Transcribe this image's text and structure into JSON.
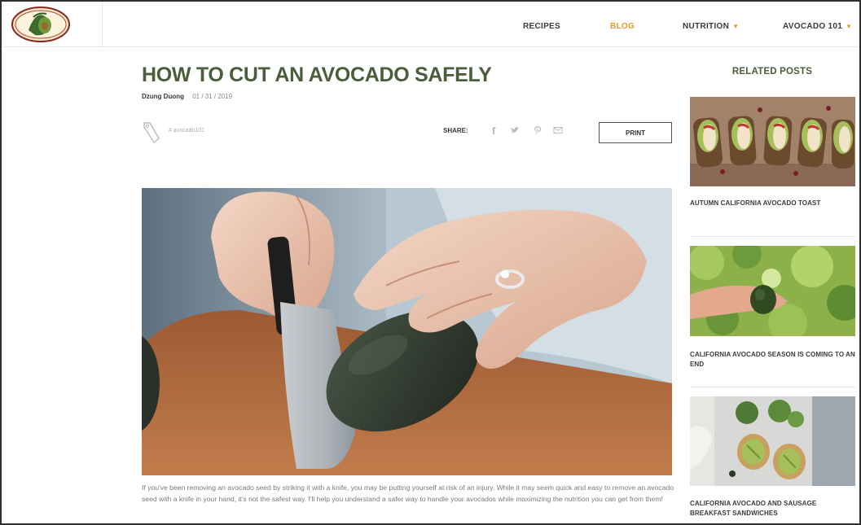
{
  "header": {
    "logo_text": "CALIFORNIA AVOCADOS",
    "nav": [
      {
        "label": "RECIPES",
        "active": false,
        "has_dropdown": false
      },
      {
        "label": "BLOG",
        "active": true,
        "has_dropdown": false
      },
      {
        "label": "NUTRITION",
        "active": false,
        "has_dropdown": true
      },
      {
        "label": "AVOCADO 101",
        "active": false,
        "has_dropdown": true
      }
    ]
  },
  "article": {
    "title": "HOW TO CUT AN AVOCADO SAFELY",
    "author": "Dzung Duong",
    "date": "01 / 31 / 2019",
    "tag": "# avocado101",
    "share_label": "SHARE:",
    "share_icons": [
      "facebook-icon",
      "twitter-icon",
      "pinterest-icon",
      "email-icon"
    ],
    "print_label": "PRINT",
    "hero_alt": "Cutting an avocado on a cutting board",
    "body": "If you've been removing an avocado seed by striking it with a knife, you may be putting yourself at risk of an injury. While it may seem quick and easy to remove an avocado seed with a knife in your hand, it's not the safest way. I'll help you understand a safer way to handle your avocados while maximizing the nutrition you can get from them!"
  },
  "sidebar": {
    "heading": "RELATED POSTS",
    "posts": [
      {
        "title": "AUTUMN CALIFORNIA AVOCADO TOAST"
      },
      {
        "title": "CALIFORNIA AVOCADO SEASON IS COMING TO AN END"
      },
      {
        "title": "CALIFORNIA AVOCADO AND SAUSAGE BREAKFAST SANDWICHES"
      }
    ]
  },
  "colors": {
    "accent": "#e29a2b",
    "title_green": "#4b5d3b",
    "body_text": "#7a7a7a"
  }
}
